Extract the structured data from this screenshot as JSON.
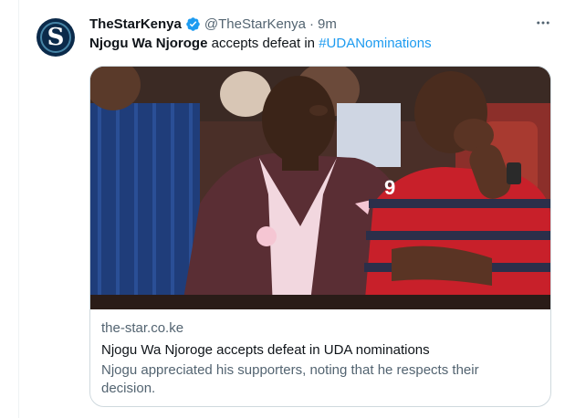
{
  "account": {
    "name": "TheStarKenya",
    "handle": "@TheStarKenya",
    "separator": "·",
    "time": "9m",
    "avatar_letter": "S"
  },
  "tweet": {
    "bold_text": "Njogu Wa Njoroge",
    "text": " accepts defeat in ",
    "hashtag": "#UDANominations"
  },
  "card": {
    "domain": "the-star.co.ke",
    "title": "Njogu Wa Njoroge accepts defeat in UDA nominations",
    "description": "Njogu appreciated his supporters, noting that he respects their decision.",
    "image_jersey_number": "9"
  },
  "icons": {
    "verified": "verified-badge-icon",
    "more": "more-options-icon"
  },
  "colors": {
    "accent": "#1d9bf0",
    "secondary_text": "#536471",
    "primary_text": "#0f1419",
    "avatar_bg": "#0b2a4a"
  }
}
